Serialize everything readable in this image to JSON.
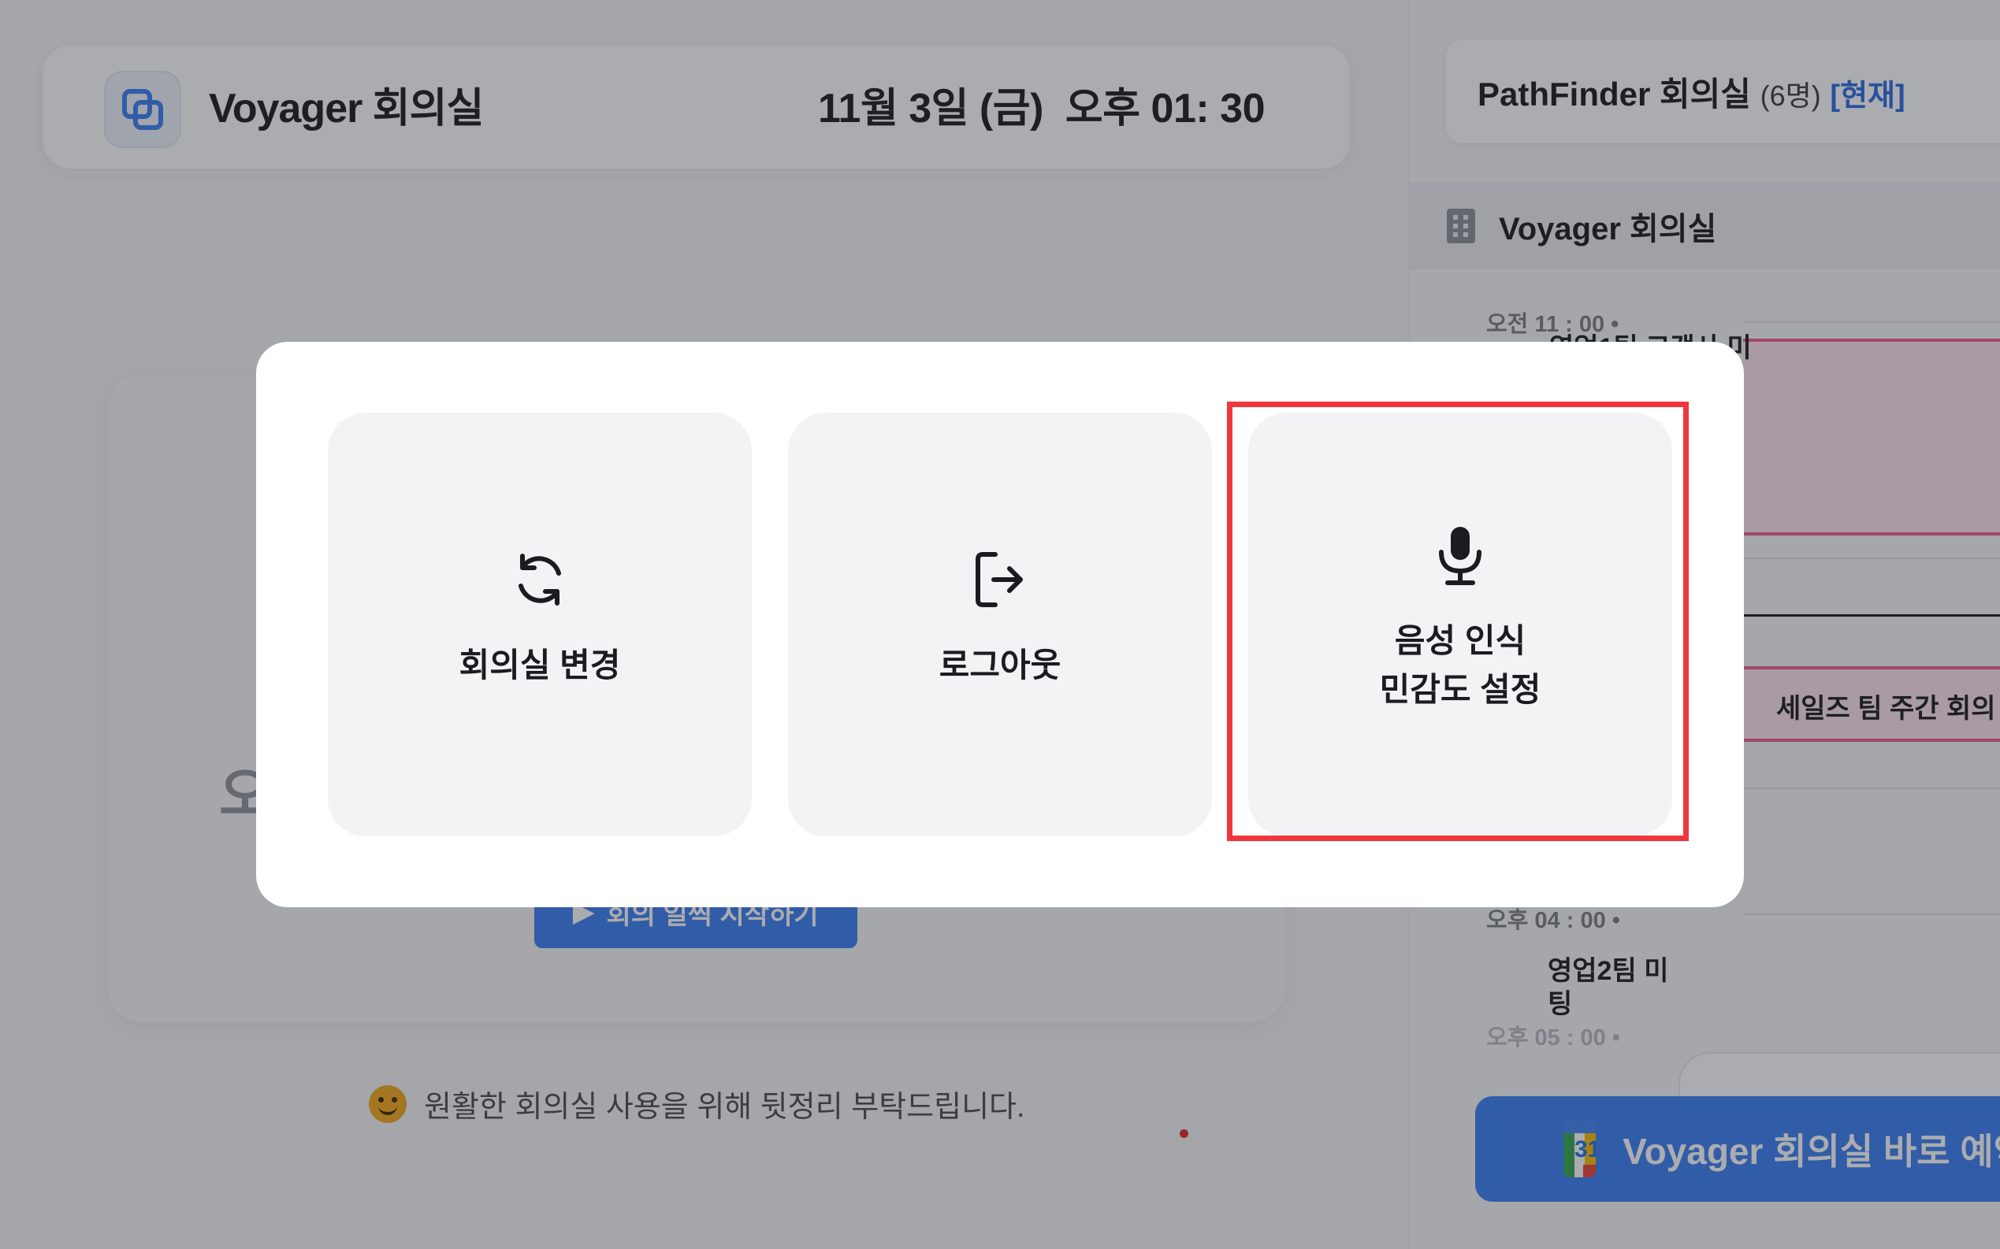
{
  "header": {
    "room_name": "Voyager 회의실",
    "date": "11월 3일 (금)",
    "time": "오후 01: 30"
  },
  "main": {
    "ghost_text": "오",
    "start_button_label": "회의 일찍 시작하기",
    "cleanup_message": "원활한 회의실 사용을 위해 뒷정리 부탁드립니다."
  },
  "right_panel": {
    "room_title": "PathFinder 회의실",
    "capacity": "(6명)",
    "current_tag": "[현재]",
    "section_label": "Voyager 회의실",
    "times": [
      "오전 11 : 00 •",
      "오후 04 : 00 •",
      "오후 05 : 00 •"
    ],
    "events": [
      {
        "title": "영업1팀 고객사 미"
      },
      {
        "title": "세일즈 팀 주간 회의"
      },
      {
        "title": "영업2팀 미팅"
      }
    ],
    "book_button_label": "Voyager 회의실 바로 예약",
    "calendar_icon_number": "31"
  },
  "modal": {
    "options": [
      {
        "label": "회의실 변경",
        "icon": "refresh-icon"
      },
      {
        "label": "로그아웃",
        "icon": "logout-icon"
      },
      {
        "label": "음성 인식\n민감도 설정",
        "icon": "microphone-icon"
      }
    ],
    "highlight_color": "#f2353d"
  },
  "colors": {
    "accent": "#3b7ef2",
    "event_pink": "#f25b95",
    "current_tag": "#2d6be6"
  }
}
